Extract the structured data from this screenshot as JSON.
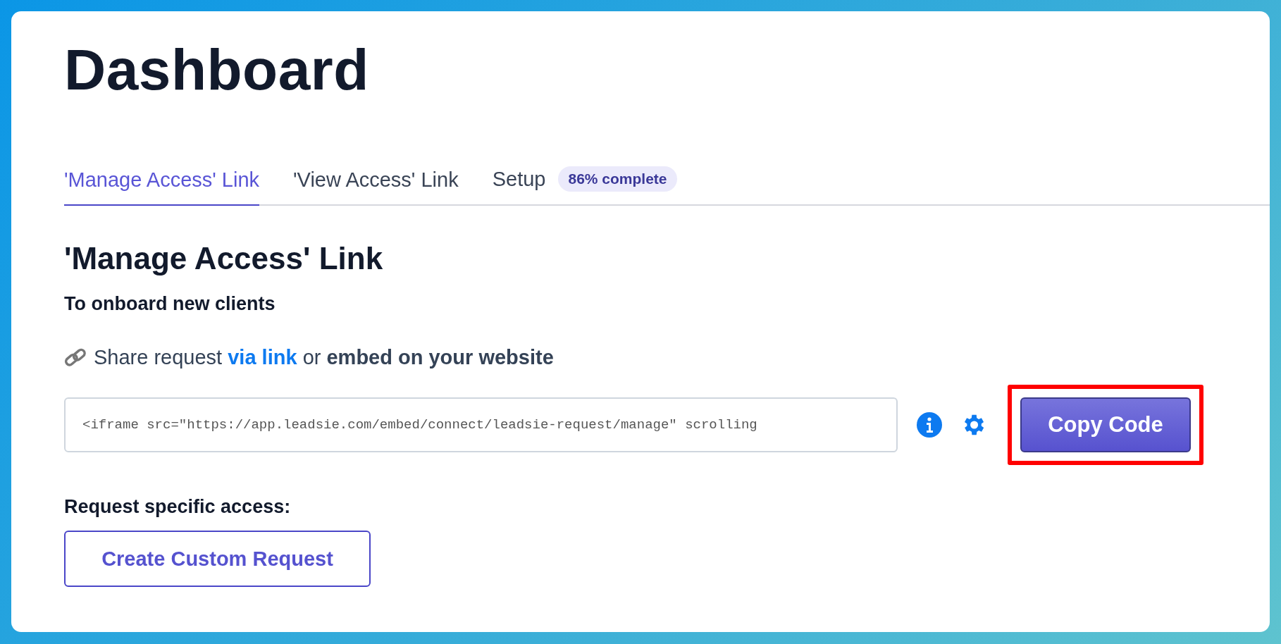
{
  "page": {
    "title": "Dashboard"
  },
  "tabs": [
    {
      "label": "'Manage Access' Link",
      "selected": true
    },
    {
      "label": "'View Access' Link",
      "selected": false
    },
    {
      "label": "Setup",
      "selected": false,
      "badge": "86% complete"
    }
  ],
  "section": {
    "heading": "'Manage Access' Link",
    "subheading": "To onboard new clients",
    "share": {
      "prefix": "Share request",
      "link": "via link",
      "suffix": "or **embed on your website**"
    },
    "embed_code": {
      "value": "<iframe src=\"https://app.leadsie.com/embed/connect/leadsie-request/manage\" scrolling"
    },
    "copy_button": {
      "label": "Copy Code",
      "highlighted": true
    },
    "specific_label": "Request specific access:",
    "custom_button": {
      "label": "Create Custom Request"
    }
  }
}
